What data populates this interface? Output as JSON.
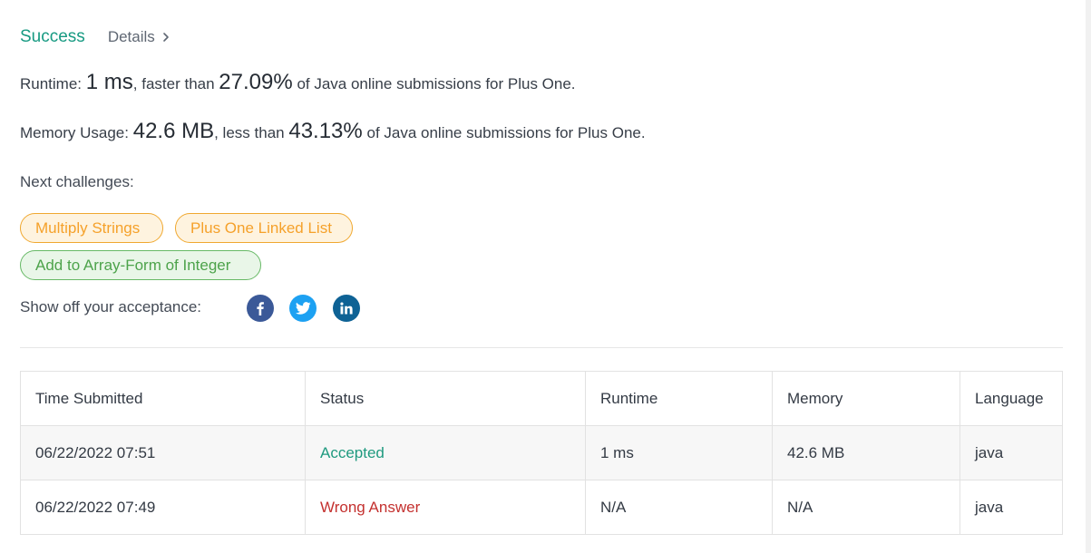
{
  "header": {
    "status": "Success",
    "details_label": "Details"
  },
  "runtime": {
    "label": "Runtime:",
    "value": "1 ms",
    "comparison": ", faster than",
    "percent": "27.09%",
    "suffix": "of Java online submissions for Plus One."
  },
  "memory": {
    "label": "Memory Usage:",
    "value": "42.6 MB",
    "comparison": ", less than",
    "percent": "43.13%",
    "suffix": "of Java online submissions for Plus One."
  },
  "next": {
    "label": "Next challenges:",
    "challenges": [
      {
        "title": "Multiply Strings",
        "difficulty_color": "#f5a12a"
      },
      {
        "title": "Plus One Linked List",
        "difficulty_color": "#f5a12a"
      },
      {
        "title": "Add to Array-Form of Integer",
        "difficulty_color": "#4da34b"
      }
    ]
  },
  "share": {
    "label": "Show off your acceptance:",
    "icons": [
      "facebook-icon",
      "twitter-icon",
      "linkedin-icon"
    ]
  },
  "table": {
    "headers": [
      "Time Submitted",
      "Status",
      "Runtime",
      "Memory",
      "Language"
    ],
    "rows": [
      {
        "time": "06/22/2022 07:51",
        "status": "Accepted",
        "runtime": "1 ms",
        "memory": "42.6 MB",
        "language": "java"
      },
      {
        "time": "06/22/2022 07:49",
        "status": "Wrong Answer",
        "runtime": "N/A",
        "memory": "N/A",
        "language": "java"
      }
    ]
  },
  "colors": {
    "success": "#179a82",
    "accepted": "#1f9a7f",
    "wrong_answer": "#c4312f",
    "medium_tag": "#f5a12a",
    "easy_tag": "#4da34b"
  }
}
